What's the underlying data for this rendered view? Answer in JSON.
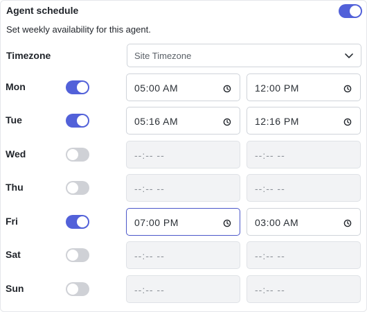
{
  "header": {
    "title": "Agent schedule",
    "subtitle": "Set weekly availability for this agent.",
    "enabled": true
  },
  "timezone": {
    "label": "Timezone",
    "value": "Site Timezone"
  },
  "colors": {
    "accent": "#5261d9",
    "toggle_off": "#cfd1d6",
    "disabled_field": "#f2f3f5"
  },
  "days": [
    {
      "label": "Mon",
      "enabled": true,
      "start": "05:00 AM",
      "end": "12:00 PM"
    },
    {
      "label": "Tue",
      "enabled": true,
      "start": "05:16 AM",
      "end": "12:16 PM"
    },
    {
      "label": "Wed",
      "enabled": false,
      "start": "--:-- --",
      "end": "--:-- --"
    },
    {
      "label": "Thu",
      "enabled": false,
      "start": "--:-- --",
      "end": "--:-- --"
    },
    {
      "label": "Fri",
      "enabled": true,
      "start": "07:00 PM",
      "end": "03:00 AM",
      "focused_field": "start"
    },
    {
      "label": "Sat",
      "enabled": false,
      "start": "--:-- --",
      "end": "--:-- --"
    },
    {
      "label": "Sun",
      "enabled": false,
      "start": "--:-- --",
      "end": "--:-- --"
    }
  ]
}
